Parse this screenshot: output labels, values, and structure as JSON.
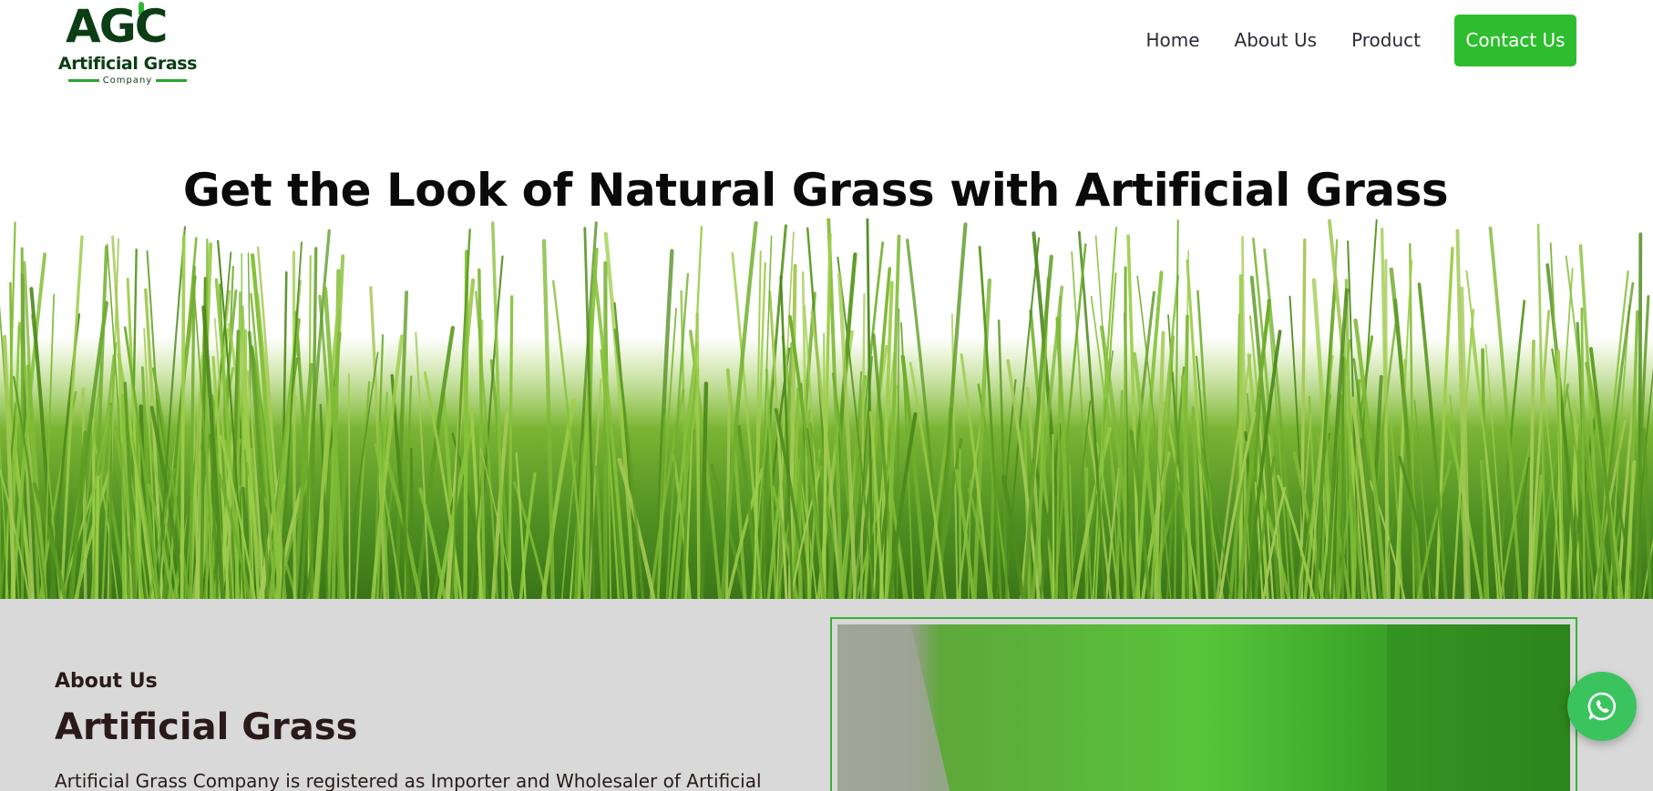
{
  "logo": {
    "monogram": "AGC",
    "name": "Artificial Grass",
    "subtitle": "Company"
  },
  "nav": {
    "items": [
      {
        "label": "Home"
      },
      {
        "label": "About Us"
      },
      {
        "label": "Product"
      }
    ],
    "cta_label": "Contact Us"
  },
  "hero": {
    "title": "Get the Look of Natural Grass with Artificial Grass"
  },
  "about": {
    "kicker": "About Us",
    "title": "Artificial Grass",
    "text": "Artificial Grass Company is registered as Importer and Wholesaler of Artificial"
  },
  "icons": {
    "whatsapp": "whatsapp-icon"
  },
  "colors": {
    "brand_dark_green": "#0c3d14",
    "cta_green": "#2dbd2f",
    "whatsapp_green": "#3bc45e",
    "section_gray": "#d9d9d9"
  }
}
